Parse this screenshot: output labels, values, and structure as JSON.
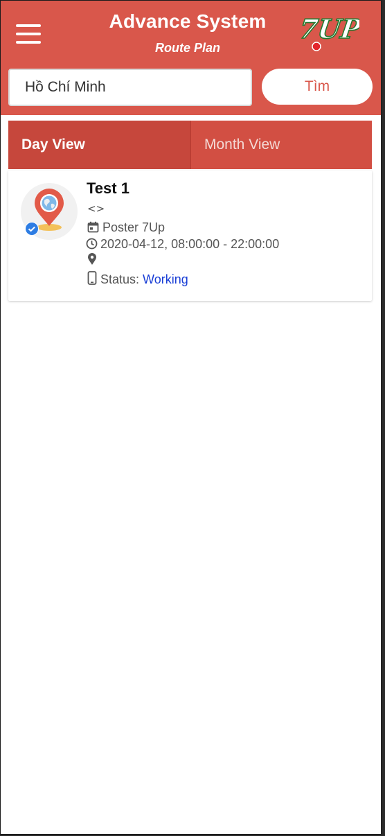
{
  "header": {
    "title": "Advance System",
    "subtitle": "Route Plan",
    "logo_text": "7UP"
  },
  "search": {
    "value": "Hồ Chí Minh",
    "button_label": "Tìm"
  },
  "tabs": [
    {
      "label": "Day View",
      "active": true
    },
    {
      "label": "Month View",
      "active": false
    }
  ],
  "plans": [
    {
      "name": "Test 1",
      "code": "<>",
      "campaign": "Poster 7Up",
      "time": "2020-04-12, 08:00:00 - 22:00:00",
      "location": "",
      "status_label": "Status:",
      "status_value": "Working"
    }
  ],
  "colors": {
    "header_bg": "#d9574b",
    "tab_active": "#c6473c",
    "status_value": "#1a3fd6",
    "check_badge": "#2e7de3"
  },
  "icons": [
    "menu-icon",
    "7up-logo",
    "map-pin-globe-icon",
    "check-badge-icon",
    "code-icon",
    "calendar-icon",
    "clock-icon",
    "location-pin-icon",
    "mobile-phone-icon"
  ]
}
